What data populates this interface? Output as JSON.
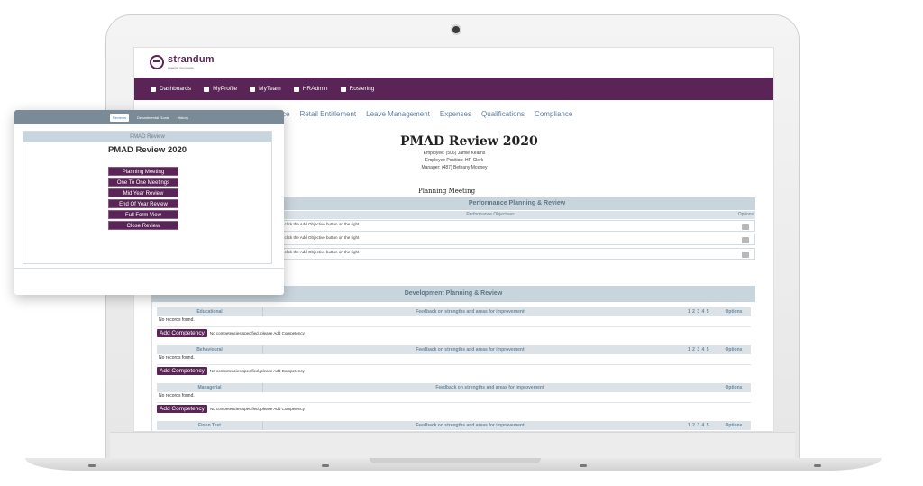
{
  "app": {
    "logo_text": "strandum",
    "logo_tagline": "powering your people"
  },
  "nav": {
    "items": [
      {
        "label": "Dashboards",
        "icon": "dashboard-icon"
      },
      {
        "label": "MyProfile",
        "icon": "user-icon"
      },
      {
        "label": "MyTeam",
        "icon": "team-icon"
      },
      {
        "label": "HRAdmin",
        "icon": "bank-icon"
      },
      {
        "label": "Rostering",
        "icon": "calendar-icon"
      }
    ]
  },
  "tabs": [
    "ce",
    "Retail Entitlement",
    "Leave Management",
    "Expenses",
    "Qualifications",
    "Compliance"
  ],
  "review": {
    "title": "PMAD Review 2020",
    "employee": "Employee: (506) Jamie Kearns",
    "position": "Employee Position: HR Clerk",
    "manager": "Manager: (487) Bethany Mooney",
    "section": "Planning Meeting",
    "performance_head": "Performance Planning & Review",
    "objectives_head": "Performance Objectives",
    "options_head": "Options",
    "objective_rows": [
      "l, click the Add Objective button on the right",
      "l, click the Add Objective button on the right",
      "l, click the Add Objective button on the right"
    ],
    "development_head": "Development Planning & Review",
    "competencies": [
      {
        "name": "Educational",
        "feedback": "Feedback on strengths and areas for improvement",
        "scale": "1 2 3 4 5",
        "options": "Options",
        "no_records": "No records found.",
        "add_label": "Add Competency",
        "add_msg": "No competencies specified, please Add Competency"
      },
      {
        "name": "Behavioural",
        "feedback": "Feedback on strengths and areas for improvement",
        "scale": "1 2 3 4 5",
        "options": "Options",
        "no_records": "No records found.",
        "add_label": "Add Competency",
        "add_msg": "No competencies specified, please Add Competency"
      },
      {
        "name": "Managerial",
        "feedback": "Feedback on strengths and areas for improvement",
        "scale": "",
        "options": "Options",
        "no_records": "No records found.",
        "add_label": "Add Competency",
        "add_msg": "No competencies specified, please Add Competency"
      },
      {
        "name": "Fionn Test",
        "feedback": "Feedback on strengths and areas for improvement",
        "scale": "1 2 3 4 5",
        "options": "Options"
      }
    ]
  },
  "overlay": {
    "tabs": [
      "Reviews",
      "Departmental Goals",
      "History"
    ],
    "panel_head": "PMAD Review",
    "title": "PMAD Review 2020",
    "buttons": [
      "Planning Meeting",
      "One To One Meetings",
      "Mid Year Review",
      "End Of Year Review",
      "Full Form View",
      "Close Review"
    ]
  },
  "colors": {
    "brand": "#5b2456",
    "panel_header": "#c9d5dd",
    "tab_link": "#5b7fa3"
  }
}
